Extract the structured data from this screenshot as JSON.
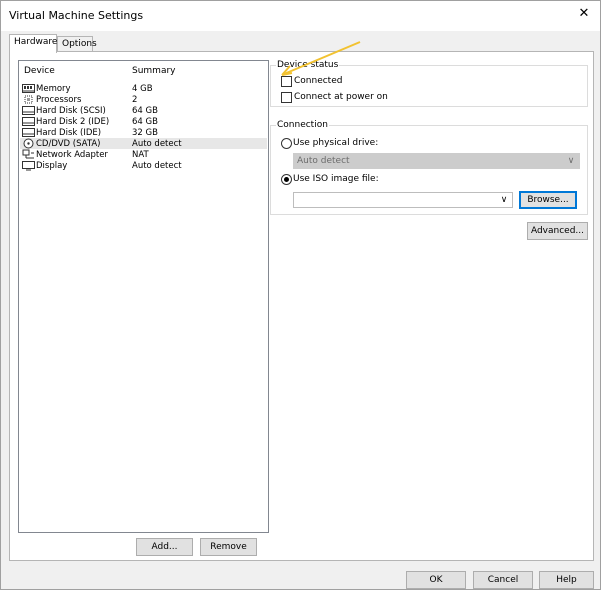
{
  "window": {
    "title": "Virtual Machine Settings",
    "close_glyph": "✕"
  },
  "tabs": [
    {
      "label": "Hardware"
    },
    {
      "label": "Options"
    }
  ],
  "device_list": {
    "headers": {
      "device": "Device",
      "summary": "Summary"
    },
    "rows": [
      {
        "device": "Memory",
        "summary": "4 GB",
        "icon": "memory-icon"
      },
      {
        "device": "Processors",
        "summary": "2",
        "icon": "processor-icon"
      },
      {
        "device": "Hard Disk (SCSI)",
        "summary": "64 GB",
        "icon": "hard-disk-icon"
      },
      {
        "device": "Hard Disk 2 (IDE)",
        "summary": "64 GB",
        "icon": "hard-disk-icon"
      },
      {
        "device": "Hard Disk (IDE)",
        "summary": "32 GB",
        "icon": "hard-disk-icon"
      },
      {
        "device": "CD/DVD (SATA)",
        "summary": "Auto detect",
        "icon": "cd-dvd-icon",
        "selected": true
      },
      {
        "device": "Network Adapter",
        "summary": "NAT",
        "icon": "network-adapter-icon"
      },
      {
        "device": "Display",
        "summary": "Auto detect",
        "icon": "display-icon"
      }
    ]
  },
  "list_buttons": {
    "add": "Add...",
    "remove": "Remove"
  },
  "device_status": {
    "title": "Device status",
    "connected": {
      "label": "Connected",
      "checked": false
    },
    "connect_at_power_on": {
      "label": "Connect at power on",
      "checked": false
    }
  },
  "connection": {
    "title": "Connection",
    "physical": {
      "label": "Use physical drive:",
      "selected": false,
      "value": "Auto detect"
    },
    "iso": {
      "label": "Use ISO image file:",
      "selected": true,
      "value": "",
      "browse": "Browse..."
    }
  },
  "advanced_button": "Advanced...",
  "footer": {
    "ok": "OK",
    "cancel": "Cancel",
    "help": "Help"
  },
  "colors": {
    "selected_row": "#e7e7e7",
    "annotation_arrow": "#f2c230",
    "focus_border": "#0078d7"
  }
}
